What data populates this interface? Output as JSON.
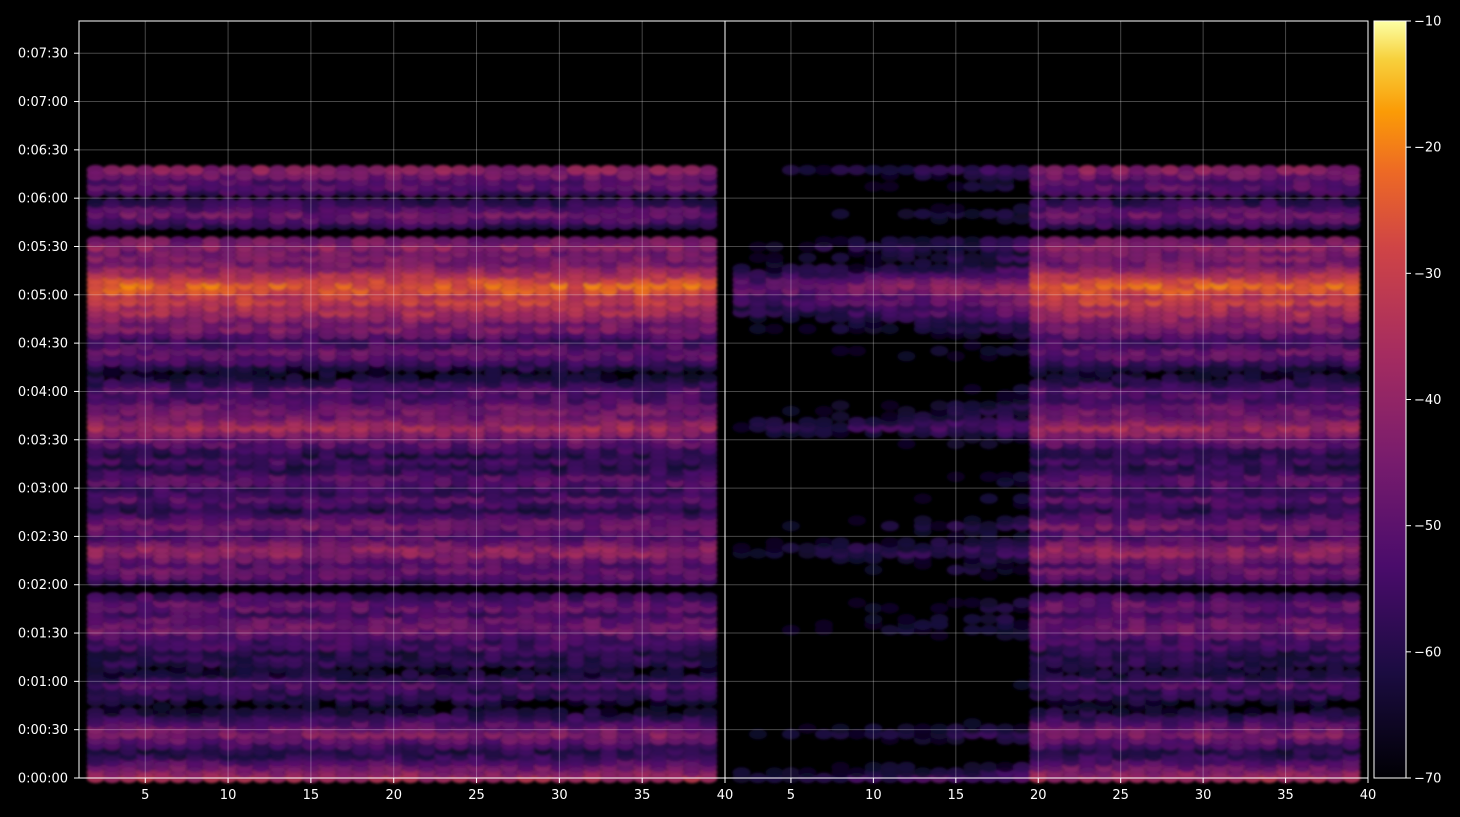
{
  "chart_data": {
    "type": "heatmap",
    "title": "",
    "xlabel": "",
    "ylabel": "",
    "grid": true,
    "colormap": "inferno",
    "panels": [
      {
        "name": "left",
        "x_ticks": [
          "5",
          "10",
          "15",
          "20",
          "25",
          "30",
          "35",
          "40"
        ],
        "x_tick_values": [
          5,
          10,
          15,
          20,
          25,
          30,
          35,
          40
        ],
        "xlim": [
          1,
          40
        ]
      },
      {
        "name": "right",
        "x_ticks": [
          "5",
          "10",
          "15",
          "20",
          "25",
          "30",
          "35",
          "40"
        ],
        "x_tick_values": [
          5,
          10,
          15,
          20,
          25,
          30,
          35,
          40
        ],
        "xlim": [
          1,
          40
        ]
      }
    ],
    "y_ticks": [
      "0:00:00",
      "0:00:30",
      "0:01:00",
      "0:01:30",
      "0:02:00",
      "0:02:30",
      "0:03:00",
      "0:03:30",
      "0:04:00",
      "0:04:30",
      "0:05:00",
      "0:05:30",
      "0:06:00",
      "0:06:30",
      "0:07:00",
      "0:07:30"
    ],
    "y_tick_seconds": [
      0,
      30,
      60,
      90,
      120,
      150,
      180,
      210,
      240,
      270,
      300,
      330,
      360,
      390,
      420,
      450
    ],
    "ylim_seconds": [
      0,
      470
    ],
    "colorbar": {
      "ticks": [
        "−10",
        "−20",
        "−30",
        "−40",
        "−50",
        "−60",
        "−70"
      ],
      "tick_values": [
        -10,
        -20,
        -30,
        -40,
        -50,
        -60,
        -70
      ],
      "range": [
        -70,
        -10
      ]
    },
    "bands": [
      {
        "t": 0,
        "level": -36
      },
      {
        "t": 28,
        "level": -42
      },
      {
        "t": 51,
        "level": -58
      },
      {
        "t": 58,
        "level": -52
      },
      {
        "t": 73,
        "level": -56
      },
      {
        "t": 83,
        "level": -52
      },
      {
        "t": 93,
        "level": -44
      },
      {
        "t": 98,
        "level": -48
      },
      {
        "t": 107,
        "level": -46
      },
      {
        "t": 128,
        "level": -46
      },
      {
        "t": 141,
        "level": -38
      },
      {
        "t": 157,
        "level": -44
      },
      {
        "t": 173,
        "level": -50
      },
      {
        "t": 185,
        "level": -48
      },
      {
        "t": 197,
        "level": -54
      },
      {
        "t": 210,
        "level": -46
      },
      {
        "t": 218,
        "level": -36
      },
      {
        "t": 229,
        "level": -44
      },
      {
        "t": 240,
        "level": -50
      },
      {
        "t": 264,
        "level": -46
      },
      {
        "t": 280,
        "level": -42
      },
      {
        "t": 290,
        "level": -34
      },
      {
        "t": 297,
        "level": -28
      },
      {
        "t": 305,
        "level": -22
      },
      {
        "t": 323,
        "level": -44
      },
      {
        "t": 330,
        "level": -40
      },
      {
        "t": 350,
        "level": -46
      },
      {
        "t": 368,
        "level": -48
      },
      {
        "t": 378,
        "level": -40
      }
    ]
  }
}
